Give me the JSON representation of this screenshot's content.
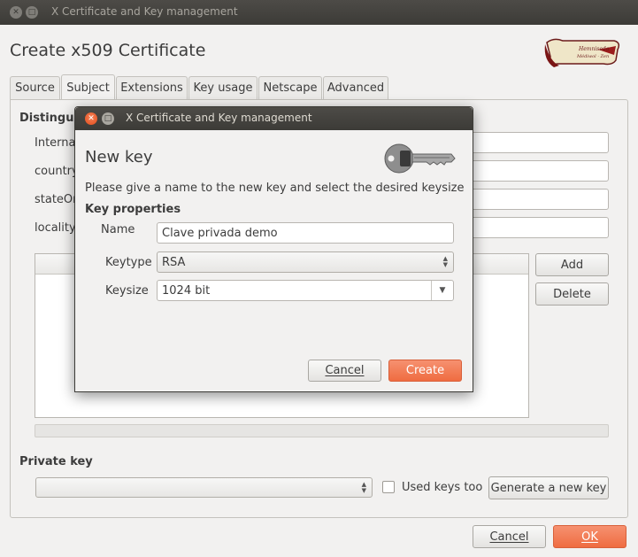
{
  "main_window": {
    "title": "X Certificate and Key management",
    "heading": "Create x509 Certificate",
    "tabs": [
      "Source",
      "Subject",
      "Extensions",
      "Key usage",
      "Netscape",
      "Advanced"
    ],
    "group_label": "Distinguis",
    "field_labels": [
      "Internal",
      "country",
      "stateOr",
      "locality"
    ],
    "add_button": "Add",
    "delete_button": "Delete",
    "private_key_label": "Private key",
    "used_keys_label": "Used keys too",
    "generate_key_button": "Generate a new key",
    "cancel_button": "Cancel",
    "ok_button": "OK"
  },
  "dialog": {
    "title": "X Certificate and Key management",
    "heading": "New key",
    "description": "Please give a name to the new key and select the desired keysize",
    "section_label": "Key properties",
    "name_label": "Name",
    "name_value": "Clave privada demo",
    "keytype_label": "Keytype",
    "keytype_value": "RSA",
    "keysize_label": "Keysize",
    "keysize_value": "1024 bit",
    "cancel_button": "Cancel",
    "create_button": "Create"
  },
  "icons": {
    "logo": "certificate-scroll-logo",
    "key": "key-icon"
  },
  "colors": {
    "accent": "#ef6c41",
    "titlebar": "#3c3b37"
  }
}
